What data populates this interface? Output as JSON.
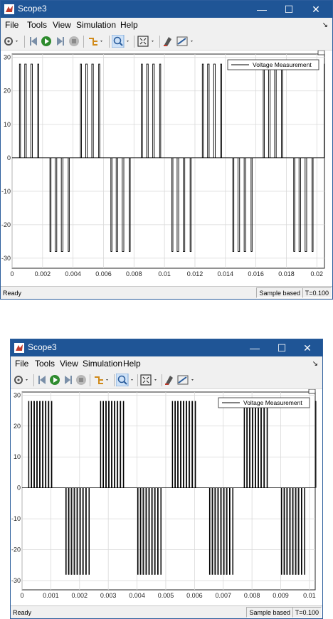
{
  "windows": [
    {
      "title": "Scope3",
      "menu": [
        "File",
        "Tools",
        "View",
        "Simulation",
        "Help"
      ],
      "legend": "Voltage Measurement",
      "status": {
        "ready": "Ready",
        "mode": "Sample based",
        "time": "T=0.100"
      },
      "chart_data": {
        "type": "line",
        "series": [
          {
            "name": "Voltage Measurement",
            "pattern": "pwm_5level_bipolar"
          }
        ],
        "fundamental_period": 0.004,
        "carrier_period": 0.0004,
        "amplitude": 28,
        "xlim": [
          0,
          0.0205
        ],
        "ylim": [
          -33,
          31
        ],
        "xticks": [
          0,
          0.002,
          0.004,
          0.006,
          0.008,
          0.01,
          0.012,
          0.014,
          0.016,
          0.018,
          0.02
        ],
        "xtick_labels": [
          "0",
          "0.002",
          "0.004",
          "0.006",
          "0.008",
          "0.01",
          "0.012",
          "0.014",
          "0.016",
          "0.018",
          "0.02"
        ],
        "yticks": [
          -30,
          -20,
          -10,
          0,
          10,
          20,
          30
        ],
        "ytick_labels": [
          "-30",
          "-20",
          "-10",
          "0",
          "10",
          "20",
          "30"
        ],
        "grid": true,
        "legend_position": "top-right"
      }
    },
    {
      "title": "Scope3",
      "menu": [
        "File",
        "Tools",
        "View",
        "Simulation",
        "Help"
      ],
      "legend": "Voltage Measurement",
      "status": {
        "ready": "Ready",
        "mode": "Sample based",
        "time": "T=0.100"
      },
      "chart_data": {
        "type": "line",
        "series": [
          {
            "name": "Voltage Measurement",
            "pattern": "pwm_5level_bipolar"
          }
        ],
        "fundamental_period": 0.0025,
        "carrier_period": 0.0001,
        "amplitude": 28,
        "xlim": [
          0,
          0.0102
        ],
        "ylim": [
          -33,
          31
        ],
        "xticks": [
          0,
          0.001,
          0.002,
          0.003,
          0.004,
          0.005,
          0.006,
          0.007,
          0.008,
          0.009,
          0.01
        ],
        "xtick_labels": [
          "0",
          "0.001",
          "0.002",
          "0.003",
          "0.004",
          "0.005",
          "0.006",
          "0.007",
          "0.008",
          "0.009",
          "0.01"
        ],
        "yticks": [
          -30,
          -20,
          -10,
          0,
          10,
          20,
          30
        ],
        "ytick_labels": [
          "-30",
          "-20",
          "-10",
          "0",
          "10",
          "20",
          "30"
        ],
        "grid": true,
        "legend_position": "top-right"
      }
    }
  ]
}
